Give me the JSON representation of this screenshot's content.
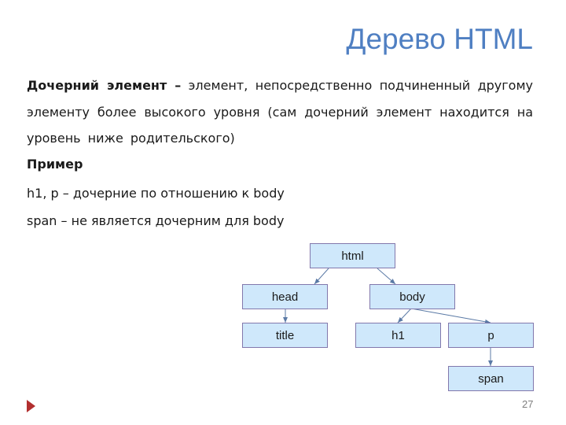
{
  "slide": {
    "title": "Дерево HTML",
    "definition": {
      "term": "Дочерний элемент –",
      "text": " элемент, непосредственно подчиненный другому элементу более высокого уровня (сам дочерний элемент находится на уровень ниже родительского)"
    },
    "example_heading": "Пример",
    "example_lines": [
      "h1, p – дочерние по отношению к body",
      "span – не является дочерним для body"
    ],
    "page_number": "27"
  },
  "tree": {
    "nodes": {
      "html": "html",
      "head": "head",
      "body": "body",
      "title": "title",
      "h1": "h1",
      "p": "p",
      "span": "span"
    },
    "edges": [
      [
        "html",
        "head"
      ],
      [
        "html",
        "body"
      ],
      [
        "head",
        "title"
      ],
      [
        "body",
        "h1"
      ],
      [
        "body",
        "p"
      ],
      [
        "p",
        "span"
      ]
    ],
    "colors": {
      "node_fill": "#cfe8fb",
      "node_border": "#8278ac",
      "edge": "#5b7aa6"
    }
  },
  "colors": {
    "title": "#4f7fc2",
    "bullet_marker": "#b22f2f"
  }
}
